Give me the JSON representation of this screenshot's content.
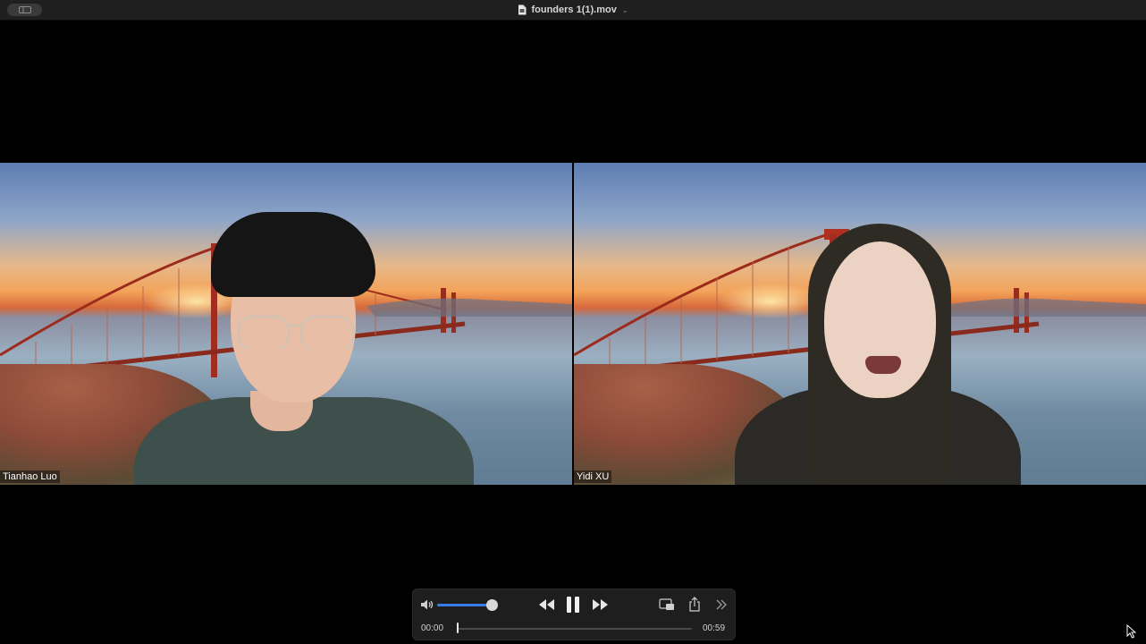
{
  "window": {
    "title": "founders 1(1).mov",
    "title_chevron": "⌄"
  },
  "participants": [
    {
      "name": "Tianhao Luo"
    },
    {
      "name": "Yidi XU"
    }
  ],
  "player": {
    "current_time": "00:00",
    "duration": "00:59",
    "volume_fraction": 0.9,
    "progress_fraction": 0.0,
    "state": "playing",
    "icons": [
      "speaker-icon",
      "rewind-icon",
      "pause-icon",
      "fast-forward-icon",
      "picture-in-picture-icon",
      "share-icon",
      "more-chevrons-icon"
    ]
  },
  "colors": {
    "accent": "#3a7de8"
  }
}
